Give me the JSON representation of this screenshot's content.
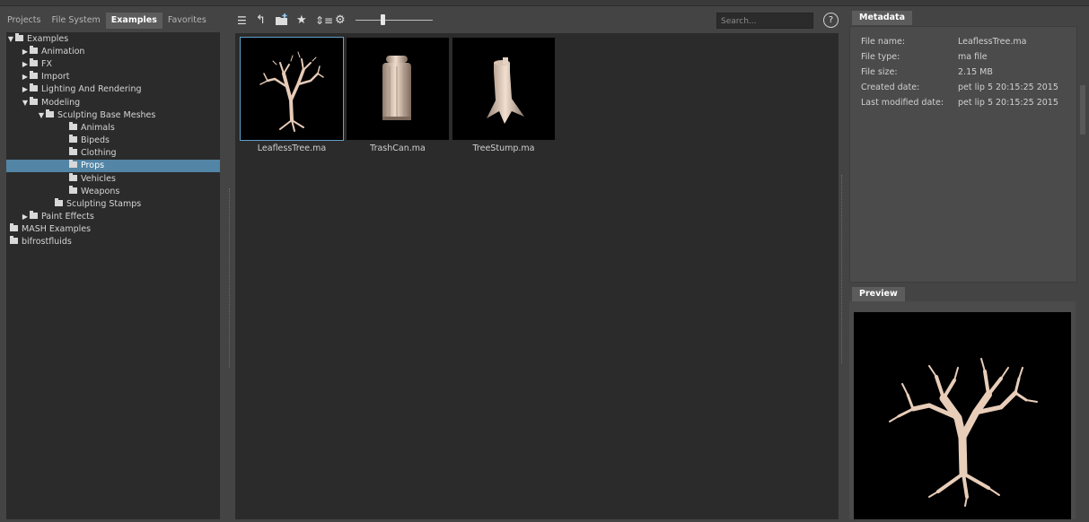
{
  "left_panel": {
    "tabs": [
      {
        "label": "Projects",
        "active": false
      },
      {
        "label": "File System",
        "active": false
      },
      {
        "label": "Examples",
        "active": true
      },
      {
        "label": "Favorites",
        "active": false
      }
    ],
    "tree": [
      {
        "label": "Examples",
        "depth": 0,
        "toggle": "expanded",
        "folder": true
      },
      {
        "label": "Animation",
        "depth": 1,
        "toggle": "collapsed",
        "folder": true
      },
      {
        "label": "FX",
        "depth": 1,
        "toggle": "collapsed",
        "folder": true
      },
      {
        "label": "Import",
        "depth": 1,
        "toggle": "collapsed",
        "folder": true
      },
      {
        "label": "Lighting And Rendering",
        "depth": 1,
        "toggle": "collapsed",
        "folder": true
      },
      {
        "label": "Modeling",
        "depth": 1,
        "toggle": "expanded",
        "folder": true
      },
      {
        "label": "Sculpting Base Meshes",
        "depth": 2,
        "toggle": "expanded",
        "folder": true
      },
      {
        "label": "Animals",
        "depth": 3,
        "toggle": "none",
        "folder": true
      },
      {
        "label": "Bipeds",
        "depth": 3,
        "toggle": "none",
        "folder": true
      },
      {
        "label": "Clothing",
        "depth": 3,
        "toggle": "none",
        "folder": true
      },
      {
        "label": "Props",
        "depth": 3,
        "toggle": "none",
        "folder": true,
        "selected": true
      },
      {
        "label": "Vehicles",
        "depth": 3,
        "toggle": "none",
        "folder": true
      },
      {
        "label": "Weapons",
        "depth": 3,
        "toggle": "none",
        "folder": true
      },
      {
        "label": "Sculpting Stamps",
        "depth": 2,
        "toggle": "none",
        "folder": true
      },
      {
        "label": "Paint Effects",
        "depth": 1,
        "toggle": "collapsed",
        "folder": true
      },
      {
        "label": "MASH Examples",
        "depth": 0,
        "toggle": "none",
        "folder": true
      },
      {
        "label": "bifrostfluids",
        "depth": 0,
        "toggle": "none",
        "folder": true
      }
    ]
  },
  "toolbar": {
    "icons": [
      "list-view-icon",
      "back-icon",
      "add-folder-icon",
      "favorite-star-icon",
      "sort-icon",
      "settings-icon"
    ],
    "thumbnail_size_fraction": 0.33,
    "search_placeholder": "Search...",
    "help_label": "?"
  },
  "files": [
    {
      "name": "LeaflessTree.ma",
      "selected": true,
      "icon": "tree-thumbnail"
    },
    {
      "name": "TrashCan.ma",
      "selected": false,
      "icon": "trashcan-thumbnail"
    },
    {
      "name": "TreeStump.ma",
      "selected": false,
      "icon": "stump-thumbnail"
    }
  ],
  "metadata": {
    "tab": "Metadata",
    "rows": [
      {
        "key": "File name:",
        "value": "LeaflessTree.ma"
      },
      {
        "key": "File type:",
        "value": "ma file"
      },
      {
        "key": "File size:",
        "value": "2.15 MB"
      },
      {
        "key": "Created date:",
        "value": "pet lip 5 20:15:25 2015"
      },
      {
        "key": "Last modified date:",
        "value": "pet lip 5 20:15:25 2015"
      }
    ]
  },
  "preview": {
    "tab": "Preview"
  },
  "colors": {
    "selection": "#5285a6",
    "panel_dark": "#2b2b2b",
    "panel_mid": "#444444",
    "model_tint": "#e6c9b6"
  }
}
